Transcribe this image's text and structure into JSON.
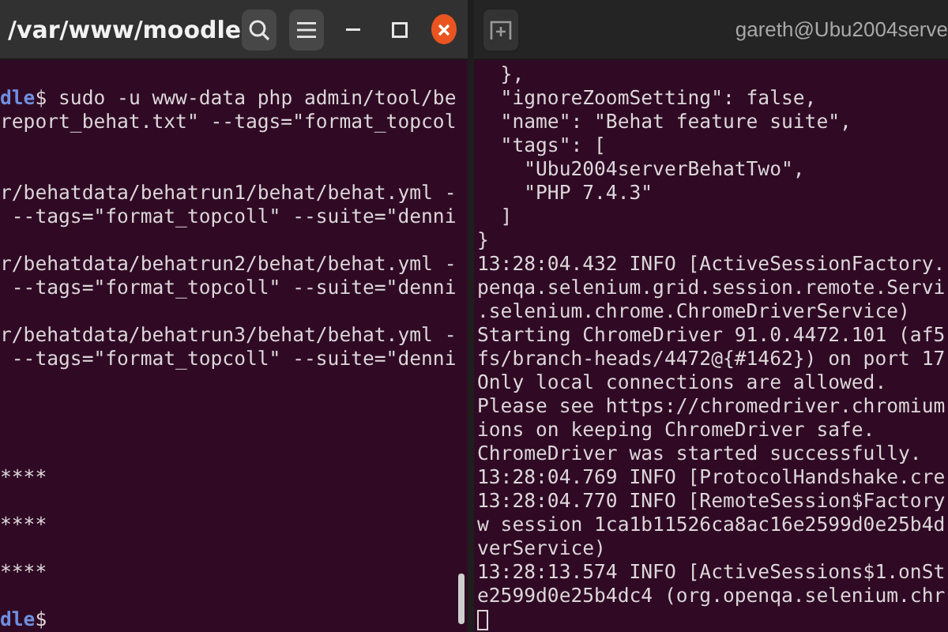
{
  "windows": [
    {
      "title": "/var/www/moodle",
      "focused": true,
      "buttons": [
        {
          "kind": "search"
        },
        {
          "kind": "menu"
        },
        {
          "kind": "minimize"
        },
        {
          "kind": "maximize"
        },
        {
          "kind": "close"
        }
      ],
      "lines": [
        {
          "kind": "prompt",
          "path": "dle",
          "text": "$ sudo -u www-data php admin/tool/be"
        },
        {
          "kind": "output",
          "text": "report_behat.txt\" --tags=\"format_topcol"
        },
        {
          "kind": "blank"
        },
        {
          "kind": "blank"
        },
        {
          "kind": "output",
          "text": "r/behatdata/behatrun1/behat/behat.yml -"
        },
        {
          "kind": "output",
          "text": " --tags=\"format_topcoll\" --suite=\"denni"
        },
        {
          "kind": "blank"
        },
        {
          "kind": "output",
          "text": "r/behatdata/behatrun2/behat/behat.yml -"
        },
        {
          "kind": "output",
          "text": " --tags=\"format_topcoll\" --suite=\"denni"
        },
        {
          "kind": "blank"
        },
        {
          "kind": "output",
          "text": "r/behatdata/behatrun3/behat/behat.yml -"
        },
        {
          "kind": "output",
          "text": " --tags=\"format_topcoll\" --suite=\"denni"
        },
        {
          "kind": "blank"
        },
        {
          "kind": "blank"
        },
        {
          "kind": "blank"
        },
        {
          "kind": "blank"
        },
        {
          "kind": "output",
          "text": "****"
        },
        {
          "kind": "blank"
        },
        {
          "kind": "output",
          "text": "****"
        },
        {
          "kind": "blank"
        },
        {
          "kind": "output",
          "text": "****"
        },
        {
          "kind": "blank"
        },
        {
          "kind": "prompt",
          "path": "dle",
          "text": "$"
        }
      ]
    },
    {
      "title": "gareth@Ubu2004serve",
      "focused": false,
      "buttons": [
        {
          "kind": "new-tab"
        }
      ],
      "lines": [
        {
          "kind": "output",
          "text": "  },"
        },
        {
          "kind": "output",
          "text": "  \"ignoreZoomSetting\": false,"
        },
        {
          "kind": "output",
          "text": "  \"name\": \"Behat feature suite\","
        },
        {
          "kind": "output",
          "text": "  \"tags\": ["
        },
        {
          "kind": "output",
          "text": "    \"Ubu2004serverBehatTwo\","
        },
        {
          "kind": "output",
          "text": "    \"PHP 7.4.3\""
        },
        {
          "kind": "output",
          "text": "  ]"
        },
        {
          "kind": "output",
          "text": "}"
        },
        {
          "kind": "output",
          "text": "13:28:04.432 INFO [ActiveSessionFactory."
        },
        {
          "kind": "output",
          "text": "penqa.selenium.grid.session.remote.Servi"
        },
        {
          "kind": "output",
          "text": ".selenium.chrome.ChromeDriverService)"
        },
        {
          "kind": "output",
          "text": "Starting ChromeDriver 91.0.4472.101 (af5"
        },
        {
          "kind": "output",
          "text": "fs/branch-heads/4472@{#1462}) on port 17"
        },
        {
          "kind": "output",
          "text": "Only local connections are allowed."
        },
        {
          "kind": "output",
          "text": "Please see https://chromedriver.chromium"
        },
        {
          "kind": "output",
          "text": "ions on keeping ChromeDriver safe."
        },
        {
          "kind": "output",
          "text": "ChromeDriver was started successfully."
        },
        {
          "kind": "output",
          "text": "13:28:04.769 INFO [ProtocolHandshake.cre"
        },
        {
          "kind": "output",
          "text": "13:28:04.770 INFO [RemoteSession$Factory"
        },
        {
          "kind": "output",
          "text": "w session 1ca1b11526ca8ac16e2599d0e25b4d"
        },
        {
          "kind": "output",
          "text": "verService)"
        },
        {
          "kind": "output",
          "text": "13:28:13.574 INFO [ActiveSessions$1.onSt"
        },
        {
          "kind": "output",
          "text": "e2599d0e25b4dc4 (org.openqa.selenium.chr"
        },
        {
          "kind": "cursor"
        }
      ]
    }
  ]
}
